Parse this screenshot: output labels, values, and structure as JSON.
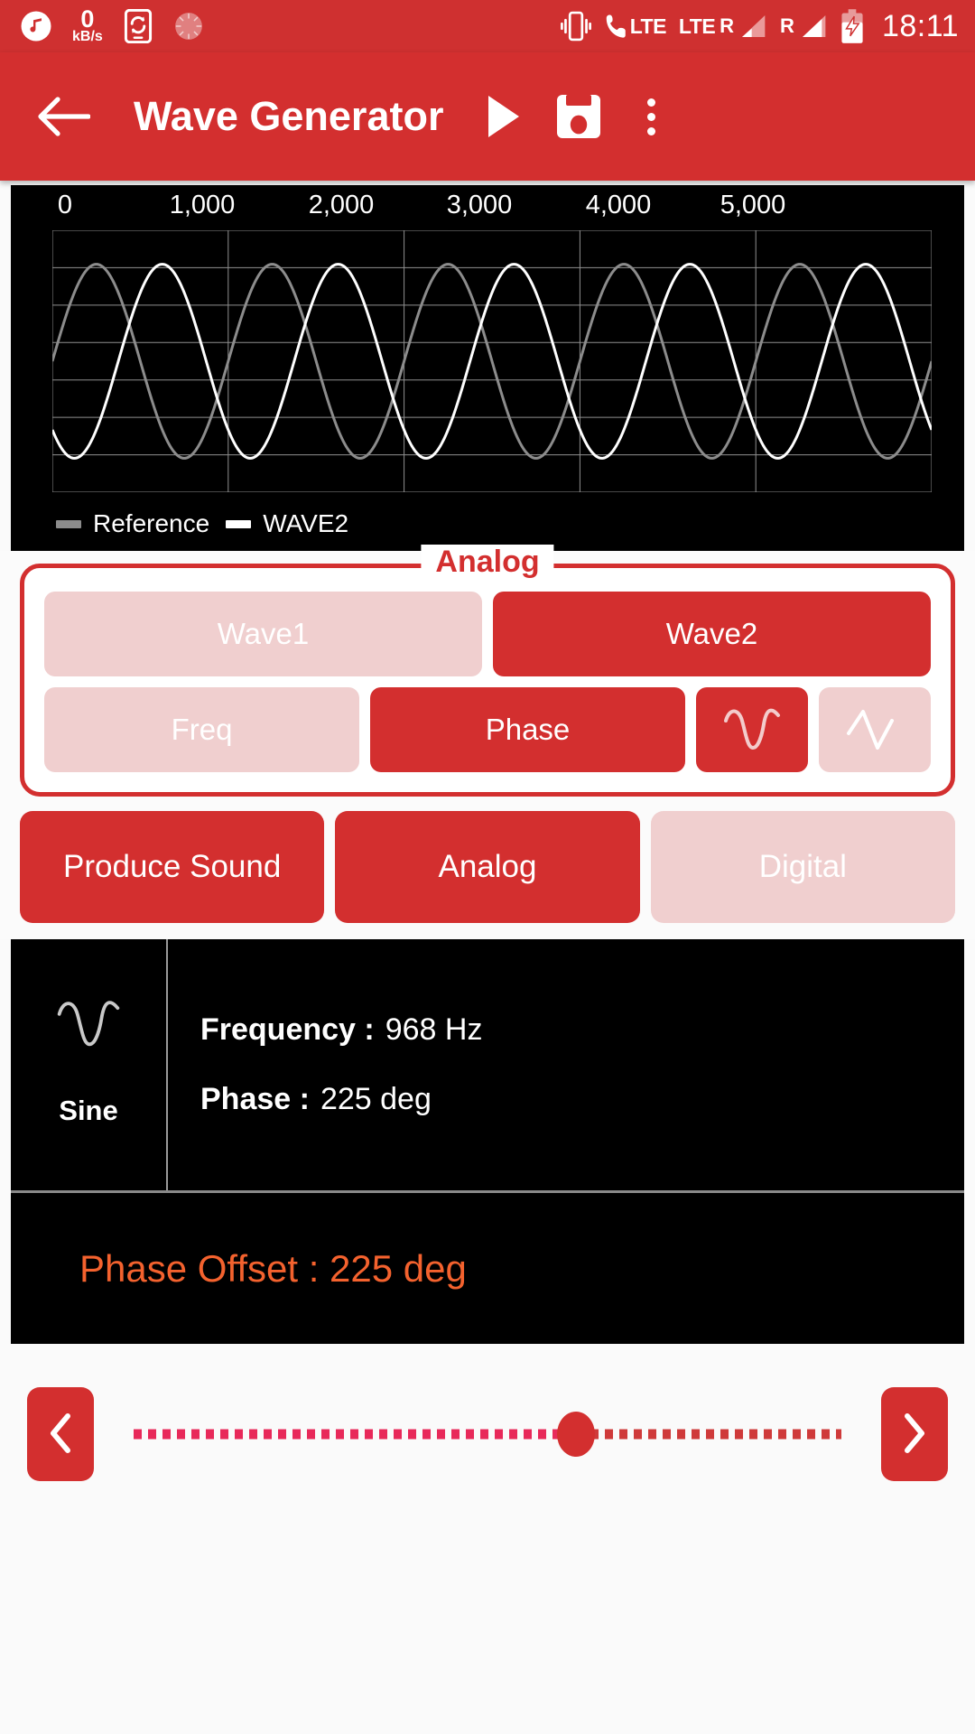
{
  "statusbar": {
    "icons": [
      "music-note-icon",
      "network-speed-icon",
      "sync-icon",
      "alarm-icon",
      "vibrate-icon",
      "call-lte-icon",
      "lte-signal-icon",
      "roaming-signal-icon",
      "battery-charging-icon"
    ],
    "speed_value": "0",
    "speed_unit": "kB/s",
    "lte_label_call": "LTE",
    "lte_label_data": "LTE",
    "roaming_label_1": "R",
    "roaming_label_2": "R",
    "clock": "18:11"
  },
  "appbar": {
    "back_icon": "back-arrow-icon",
    "title": "Wave Generator",
    "play_icon": "play-icon",
    "save_icon": "save-icon",
    "overflow_icon": "overflow-menu-icon"
  },
  "chart_data": {
    "type": "line",
    "title": "",
    "xlabel": "",
    "ylabel": "",
    "xlim": [
      0,
      5000
    ],
    "ylim": [
      -1.35,
      1.35
    ],
    "xticks": [
      "0",
      "1,000",
      "2,000",
      "3,000",
      "4,000",
      "5,000"
    ],
    "xtick_values": [
      0,
      1000,
      2000,
      3000,
      4000,
      5000
    ],
    "grid": true,
    "grid_rows": 7,
    "grid_cols": 4,
    "background": "#000000",
    "legend_position": "bottom-left",
    "series": [
      {
        "name": "Reference",
        "color": "#8c8c8c",
        "amplitude": 1.0,
        "cycles": 5,
        "phase_deg": 0,
        "points_x": [
          0,
          250,
          500,
          750,
          1000,
          1250,
          1500,
          1750,
          2000,
          2250,
          2500,
          2750,
          3000,
          3250,
          3500,
          3750,
          4000,
          4250,
          4500,
          4750,
          5000
        ],
        "points_y": [
          0,
          1,
          0,
          -1,
          0,
          1,
          0,
          -1,
          0,
          1,
          0,
          -1,
          0,
          1,
          0,
          -1,
          0,
          1,
          0,
          -1,
          0
        ]
      },
      {
        "name": "WAVE2",
        "color": "#ffffff",
        "amplitude": 1.0,
        "cycles": 5,
        "phase_deg": 225,
        "points_x": [
          0,
          250,
          500,
          750,
          1000,
          1250,
          1500,
          1750,
          2000,
          2250,
          2500,
          2750,
          3000,
          3250,
          3500,
          3750,
          4000,
          4250,
          4500,
          4750,
          5000
        ],
        "points_y": [
          -0.707,
          -0.707,
          0.707,
          0.707,
          -0.707,
          -0.707,
          0.707,
          0.707,
          -0.707,
          -0.707,
          0.707,
          0.707,
          -0.707,
          -0.707,
          0.707,
          0.707,
          -0.707,
          -0.707,
          0.707,
          0.707,
          -0.707
        ]
      }
    ],
    "legend": [
      {
        "label": "Reference",
        "color": "#8c8c8c"
      },
      {
        "label": "WAVE2",
        "color": "#ffffff"
      }
    ]
  },
  "analog_panel": {
    "legend": "Analog",
    "wave_buttons": [
      {
        "label": "Wave1",
        "active": false
      },
      {
        "label": "Wave2",
        "active": true
      }
    ],
    "param_buttons": [
      {
        "label": "Freq",
        "active": false
      },
      {
        "label": "Phase",
        "active": true
      }
    ],
    "shape_buttons": [
      {
        "icon": "sine-wave-icon",
        "active": true
      },
      {
        "icon": "triangle-wave-icon",
        "active": false
      }
    ]
  },
  "mode_buttons": [
    {
      "label": "Produce Sound",
      "active": true
    },
    {
      "label": "Analog",
      "active": true
    },
    {
      "label": "Digital",
      "active": false
    }
  ],
  "info_panel": {
    "wave_icon": "sine-wave-icon",
    "wave_name": "Sine",
    "frequency_label": "Frequency :",
    "frequency_value": "968 Hz",
    "phase_label": "Phase :",
    "phase_value": "225 deg"
  },
  "offset_panel": {
    "text": "Phase Offset :  225 deg",
    "color": "#f4622e"
  },
  "slider": {
    "prev_icon": "chevron-left-icon",
    "next_icon": "chevron-right-icon",
    "value_percent": 62.5
  },
  "colors": {
    "brand": "#d32f2f",
    "brand_dark": "#cf3030",
    "inactive": "#f0cfcf",
    "accent_orange": "#f4622e"
  }
}
